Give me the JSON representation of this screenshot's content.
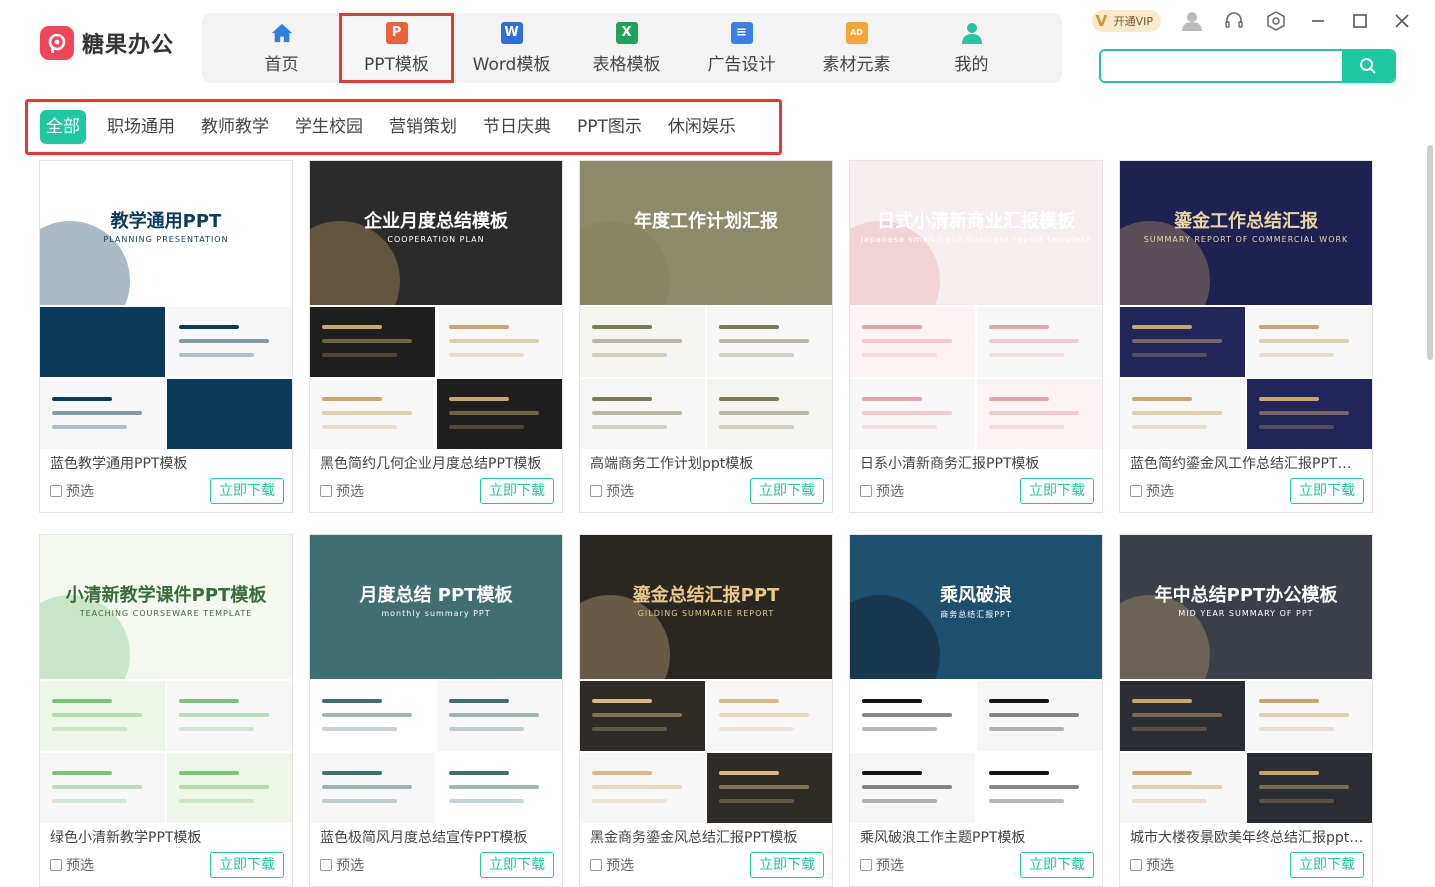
{
  "app": {
    "name": "糖果办公"
  },
  "nav": [
    {
      "label": "首页",
      "icon": "home-icon",
      "color": "#2f7fe0"
    },
    {
      "label": "PPT模板",
      "icon": "ppt-icon",
      "color": "#e8623c",
      "glyph": "P",
      "selected": true
    },
    {
      "label": "Word模板",
      "icon": "word-icon",
      "color": "#2f6fd9",
      "glyph": "W"
    },
    {
      "label": "表格模板",
      "icon": "excel-icon",
      "color": "#1fa35c",
      "glyph": "X"
    },
    {
      "label": "广告设计",
      "icon": "ad-design-icon",
      "color": "#3d7ee6",
      "glyph": "≡"
    },
    {
      "label": "素材元素",
      "icon": "material-icon",
      "color": "#f4a53a",
      "glyph": "AD"
    },
    {
      "label": "我的",
      "icon": "user-icon",
      "color": "#1fc7a0"
    }
  ],
  "header": {
    "vip_label": "开通VIP",
    "search_placeholder": ""
  },
  "categories": [
    "全部",
    "职场通用",
    "教师教学",
    "学生校园",
    "营销策划",
    "节日庆典",
    "PPT图示",
    "休闲娱乐"
  ],
  "card_labels": {
    "preview": "预选",
    "download": "立即下载"
  },
  "templates": [
    {
      "title": "蓝色教学通用PPT模板",
      "cover_title": "教学通用PPT",
      "cover_sub": "PLANNING  PRESENTATION",
      "theme": {
        "bg": "#ffffff",
        "fg": "#0d3b5c",
        "accent": "#0d3b5c",
        "sub": "#0d3b5c"
      }
    },
    {
      "title": "黑色简约几何企业月度总结PPT模板",
      "cover_title": "企业月度总结模板",
      "cover_sub": "COOPERATION PLAN",
      "theme": {
        "bg": "#2b2b2b",
        "fg": "#ffffff",
        "accent": "#c9a66b",
        "sub": "#1e1e1e"
      }
    },
    {
      "title": "高端商务工作计划ppt模板",
      "cover_title": "年度工作计划汇报",
      "cover_sub": "",
      "theme": {
        "bg": "#8c8a6a",
        "fg": "#ffffff",
        "accent": "#7d7a52",
        "sub": "#f4f4f0"
      }
    },
    {
      "title": "日系小清新商务汇报PPT模板",
      "cover_title": "日式小清新商业汇报模板",
      "cover_sub": "Japanese small fresh business report template",
      "theme": {
        "bg": "#f6eeee",
        "fg": "#ffffff",
        "accent": "#e8a4a8",
        "sub": "#fbf3f4"
      }
    },
    {
      "title": "蓝色简约鎏金风工作总结汇报PPT模板",
      "cover_title": "鎏金工作总结汇报",
      "cover_sub": "SUMMARY REPORT OF COMMERCIAL WORK",
      "theme": {
        "bg": "#1f2150",
        "fg": "#e8d6a6",
        "accent": "#c9a66b",
        "sub": "#22255a"
      }
    },
    {
      "title": "绿色小清新教学PPT模板",
      "cover_title": "小清新教学课件PPT模板",
      "cover_sub": "TEACHING COURSEWARE TEMPLATE",
      "theme": {
        "bg": "#f4f8f1",
        "fg": "#3a6b3a",
        "accent": "#7cc37a",
        "sub": "#eef6ea"
      }
    },
    {
      "title": "蓝色极简风月度总结宣传PPT模板",
      "cover_title": "月度总结 PPT模板",
      "cover_sub": "monthly summary PPT",
      "theme": {
        "bg": "#3f6f70",
        "fg": "#ffffff",
        "accent": "#3f6f70",
        "sub": "#ffffff"
      }
    },
    {
      "title": "黑金商务鎏金风总结汇报PPT模板",
      "cover_title": "鎏金总结汇报PPT",
      "cover_sub": "GILDING SUMMARIE REPORT",
      "theme": {
        "bg": "#2a2723",
        "fg": "#e8c98a",
        "accent": "#d9b98a",
        "sub": "#2f2b26"
      }
    },
    {
      "title": "乘风破浪工作主题PPT模板",
      "cover_title": "乘风破浪",
      "cover_sub": "商务总结汇报PPT",
      "theme": {
        "bg": "#1d4f6e",
        "fg": "#ffffff",
        "accent": "#111111",
        "sub": "#ffffff"
      }
    },
    {
      "title": "城市大楼夜景欧美年终总结汇报ppt模板",
      "cover_title": "年中总结PPT办公模板",
      "cover_sub": "MID YEAR SUMMARY OF PPT",
      "theme": {
        "bg": "#3a3f4a",
        "fg": "#ffffff",
        "accent": "#c9a66b",
        "sub": "#2a2d33"
      }
    }
  ]
}
